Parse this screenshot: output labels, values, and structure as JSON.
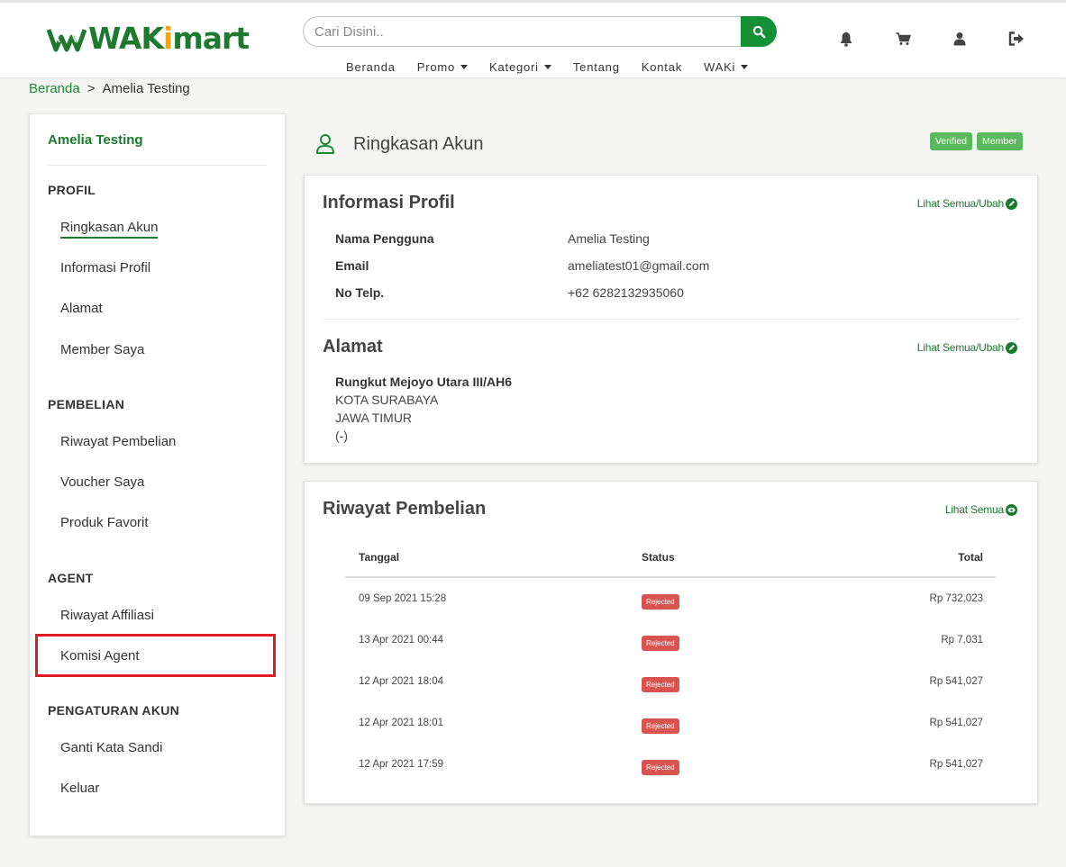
{
  "header": {
    "logo": {
      "part1": "WAK",
      "part2": "i",
      "part3": "mart"
    },
    "search": {
      "placeholder": "Cari Disini.."
    },
    "nav": [
      {
        "label": "Beranda",
        "dropdown": false
      },
      {
        "label": "Promo",
        "dropdown": true
      },
      {
        "label": "Kategori",
        "dropdown": true
      },
      {
        "label": "Tentang",
        "dropdown": false
      },
      {
        "label": "Kontak",
        "dropdown": false
      },
      {
        "label": "WAKi",
        "dropdown": true
      }
    ],
    "icons": [
      "bell-icon",
      "cart-icon",
      "user-icon",
      "logout-icon"
    ]
  },
  "breadcrumb": {
    "home": "Beranda",
    "separator": ">",
    "current": "Amelia Testing"
  },
  "sidebar": {
    "user_name": "Amelia Testing",
    "sections": {
      "profil": "PROFIL",
      "pembelian": "PEMBELIAN",
      "agent": "AGENT",
      "pengaturan": "PENGATURAN AKUN"
    },
    "items": {
      "ringkasan": "Ringkasan Akun",
      "informasi": "Informasi Profil",
      "alamat": "Alamat",
      "member": "Member Saya",
      "riwayat_pembelian": "Riwayat Pembelian",
      "voucher": "Voucher Saya",
      "favorit": "Produk Favorit",
      "afiliasi": "Riwayat Affiliasi",
      "komisi": "Komisi Agent",
      "sandi": "Ganti Kata Sandi",
      "keluar": "Keluar"
    }
  },
  "main": {
    "title": "Ringkasan Akun",
    "badges": [
      "Verified",
      "Member"
    ],
    "profile": {
      "heading": "Informasi Profil",
      "link": "Lihat Semua/Ubah",
      "fields": {
        "username_label": "Nama Pengguna",
        "username": "Amelia Testing",
        "email_label": "Email",
        "email": "ameliatest01@gmail.com",
        "phone_label": "No Telp.",
        "phone": "+62 6282132935060"
      }
    },
    "address": {
      "heading": "Alamat",
      "link": "Lihat Semua/Ubah",
      "street": "Rungkut Mejoyo Utara III/AH6",
      "city": "KOTA SURABAYA",
      "province": "JAWA TIMUR",
      "extra": "(-)"
    },
    "history": {
      "heading": "Riwayat Pembelian",
      "link": "Lihat Semua",
      "columns": {
        "date": "Tanggal",
        "status": "Status",
        "total": "Total"
      },
      "rows": [
        {
          "date": "09 Sep 2021 15:28",
          "status": "Rejected",
          "total": "Rp 732,023"
        },
        {
          "date": "13 Apr 2021 00:44",
          "status": "Rejected",
          "total": "Rp 7,031"
        },
        {
          "date": "12 Apr 2021 18:04",
          "status": "Rejected",
          "total": "Rp 541,027"
        },
        {
          "date": "12 Apr 2021 18:01",
          "status": "Rejected",
          "total": "Rp 541,027"
        },
        {
          "date": "12 Apr 2021 17:59",
          "status": "Rejected",
          "total": "Rp 541,027"
        }
      ]
    }
  },
  "colors": {
    "brand_green": "#149036",
    "accent_orange": "#f2a41c",
    "rejected_red": "#d9534f",
    "verified_green": "#5cb85c",
    "highlight_red": "#e01b24"
  }
}
